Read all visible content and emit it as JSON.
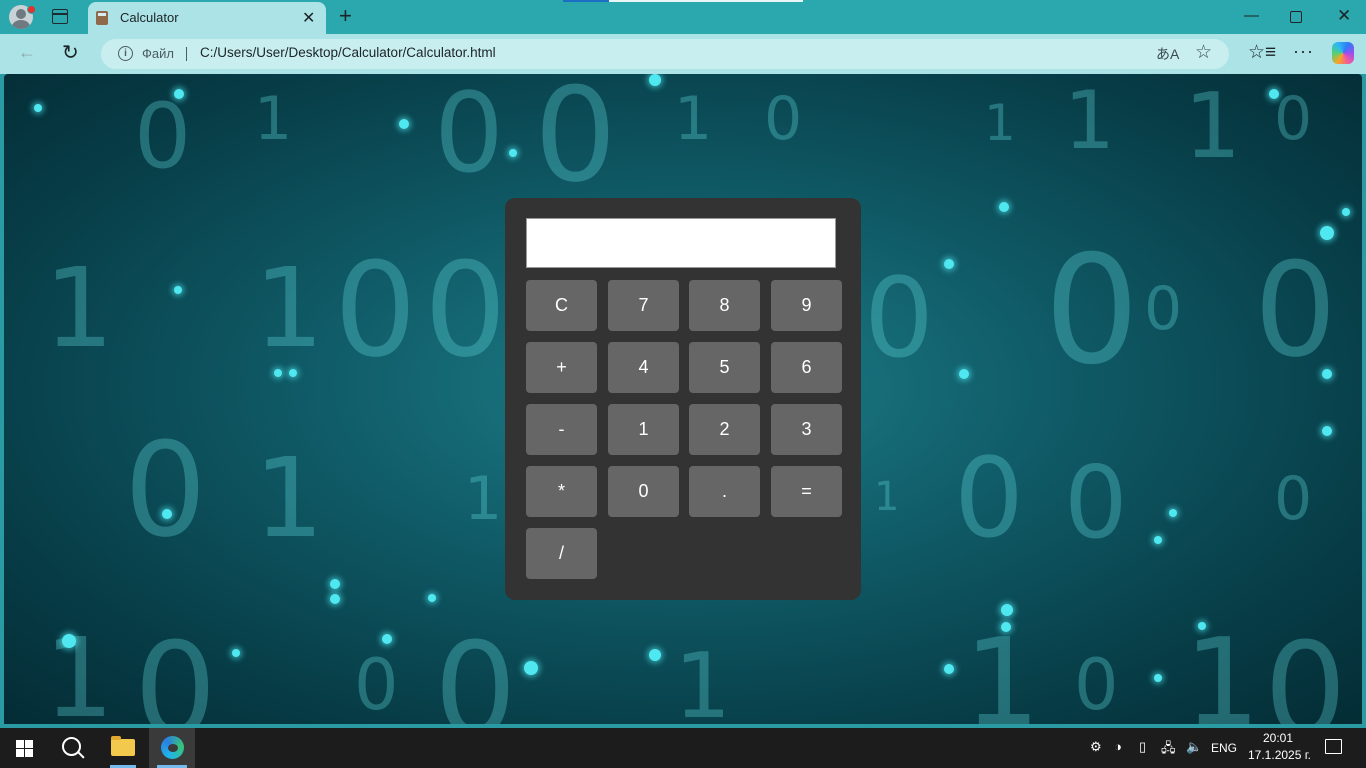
{
  "browser": {
    "tab_title": "Calculator",
    "scheme_label": "Файл",
    "url": "C:/Users/User/Desktop/Calculator/Calculator.html",
    "new_tab_glyph": "+",
    "close_tab_glyph": "✕"
  },
  "calculator": {
    "display_value": "",
    "keys": [
      "C",
      "7",
      "8",
      "9",
      "+",
      "4",
      "5",
      "6",
      "-",
      "1",
      "2",
      "3",
      "*",
      "0",
      ".",
      "=",
      "/"
    ]
  },
  "taskbar": {
    "language": "ENG",
    "time": "20:01",
    "date": "17.1.2025 г."
  },
  "icons": {
    "accent": "#76b9ed",
    "calculator_bg": "#333333",
    "key_bg": "#666666"
  }
}
